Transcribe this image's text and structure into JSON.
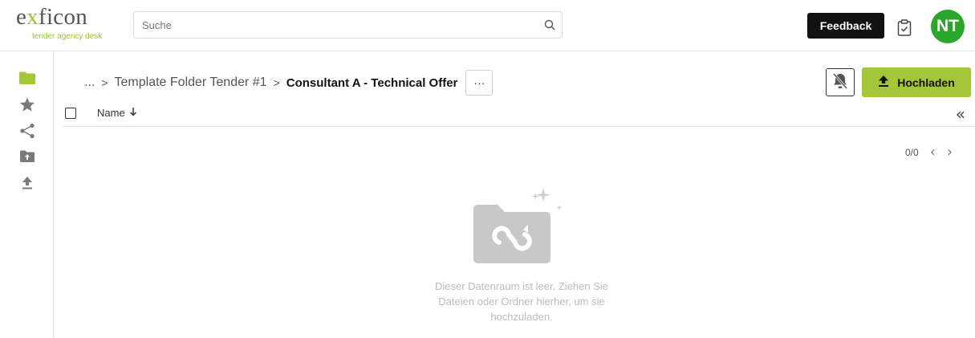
{
  "header": {
    "logo_prefix": "e",
    "logo_x": "x",
    "logo_suffix": "ficon",
    "logo_tagline": "tender agency desk",
    "search_placeholder": "Suche",
    "feedback_label": "Feedback",
    "avatar_initials": "NT"
  },
  "sidebar": {
    "items": [
      {
        "icon": "folder-icon"
      },
      {
        "icon": "star-icon"
      },
      {
        "icon": "share-icon"
      },
      {
        "icon": "folder-upload-icon"
      },
      {
        "icon": "upload-icon"
      }
    ]
  },
  "breadcrumb": {
    "ellipsis": "...",
    "separator": ">",
    "parent": "Template Folder Tender #1",
    "current": "Consultant A - Technical Offer",
    "more_label": "···"
  },
  "toolbar": {
    "upload_label": "Hochladen"
  },
  "list": {
    "column_name": "Name",
    "collapse_glyph": "«"
  },
  "pagination": {
    "count": "0/0"
  },
  "empty_state": {
    "message": "Dieser Datenraum ist leer. Ziehen Sie Dateien oder Ordner hierher, um sie hochzuladen."
  },
  "colors": {
    "brand_green": "#a4c639",
    "avatar_green": "#2aa72a",
    "feedback_bg": "#111111"
  }
}
